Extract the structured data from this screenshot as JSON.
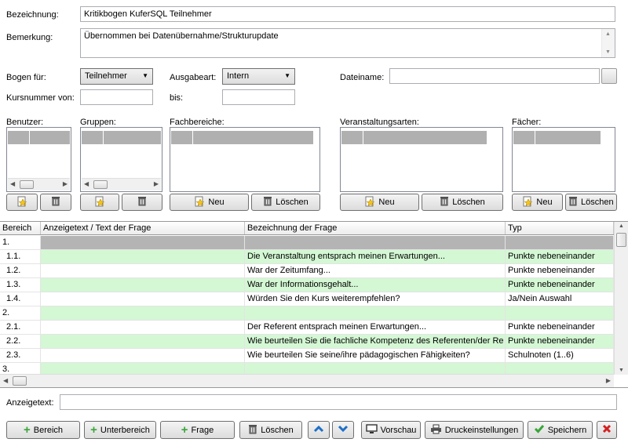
{
  "form": {
    "bezeichnung_label": "Bezeichnung:",
    "bezeichnung_value": "Kritikbogen KuferSQL Teilnehmer",
    "bemerkung_label": "Bemerkung:",
    "bemerkung_value": "Übernommen bei Datenübernahme/Strukturupdate",
    "bogen_label": "Bogen für:",
    "bogen_value": "Teilnehmer",
    "ausgabeart_label": "Ausgabeart:",
    "ausgabeart_value": "Intern",
    "dateiname_label": "Dateiname:",
    "dateiname_value": "",
    "kursnummer_label": "Kursnummer von:",
    "kursnummer_von_value": "",
    "bis_label": "bis:",
    "bis_value": ""
  },
  "lists": {
    "benutzer": "Benutzer:",
    "gruppen": "Gruppen:",
    "fachbereiche": "Fachbereiche:",
    "veranstaltungsarten": "Veranstaltungsarten:",
    "faecher": "Fächer:",
    "neu": "Neu",
    "loeschen": "Löschen",
    "loeschen_short": "Löschen"
  },
  "grid": {
    "headers": [
      "Bereich",
      "Anzeigetext / Text der Frage",
      "Bezeichnung der Frage",
      "Typ"
    ],
    "rows": [
      {
        "c1": "1.",
        "c2": "",
        "c3": "",
        "c4": "",
        "style": "selected"
      },
      {
        "c1": "1.1.",
        "c2": "",
        "c3": "Die Veranstaltung entsprach meinen Erwartungen...",
        "c4": "Punkte nebeneinander",
        "style": "green"
      },
      {
        "c1": "1.2.",
        "c2": "",
        "c3": "War der Zeitumfang...",
        "c4": "Punkte nebeneinander",
        "style": "white"
      },
      {
        "c1": "1.3.",
        "c2": "",
        "c3": "War der Informationsgehalt...",
        "c4": "Punkte nebeneinander",
        "style": "green"
      },
      {
        "c1": "1.4.",
        "c2": "",
        "c3": "Würden Sie den Kurs weiterempfehlen?",
        "c4": "Ja/Nein Auswahl",
        "style": "white"
      },
      {
        "c1": "2.",
        "c2": "",
        "c3": "",
        "c4": "",
        "style": "green"
      },
      {
        "c1": "2.1.",
        "c2": "",
        "c3": "Der Referent entsprach meinen Erwartungen...",
        "c4": "Punkte nebeneinander",
        "style": "white"
      },
      {
        "c1": "2.2.",
        "c2": "",
        "c3": "Wie beurteilen Sie die fachliche Kompetenz des Referenten/der Re",
        "c4": "Punkte nebeneinander",
        "style": "green"
      },
      {
        "c1": "2.3.",
        "c2": "",
        "c3": "Wie beurteilen Sie seine/ihre pädagogischen Fähigkeiten?",
        "c4": "Schulnoten (1..6)",
        "style": "white"
      },
      {
        "c1": "3.",
        "c2": "",
        "c3": "",
        "c4": "",
        "style": "green"
      }
    ]
  },
  "anzeigetext_label": "Anzeigetext:",
  "anzeigetext_value": "",
  "toolbar": {
    "bereich": "Bereich",
    "unterbereich": "Unterbereich",
    "frage": "Frage",
    "loeschen": "Löschen",
    "vorschau": "Vorschau",
    "druckeinstellungen": "Druckeinstellungen",
    "speichern": "Speichern"
  },
  "colors": {
    "green_row": "#d4f7d4",
    "selected_row": "#b4b4b4",
    "plus_green": "#3aa53a",
    "arrow_blue": "#1e6fc9",
    "close_red": "#d42020"
  }
}
